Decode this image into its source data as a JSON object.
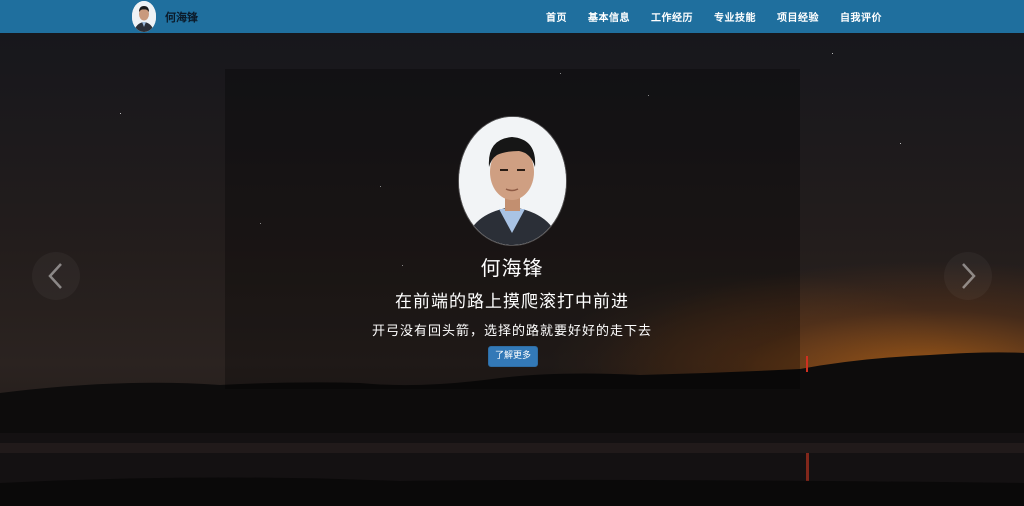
{
  "brand": {
    "name": "何海锋",
    "avatar_icon": "profile-photo"
  },
  "nav": {
    "items": [
      {
        "label": "首页"
      },
      {
        "label": "基本信息"
      },
      {
        "label": "工作经历"
      },
      {
        "label": "专业技能"
      },
      {
        "label": "项目经验"
      },
      {
        "label": "自我评价"
      }
    ]
  },
  "hero": {
    "name": "何海锋",
    "motto": "在前端的路上摸爬滚打中前进",
    "subtitle": "开弓没有回头箭，选择的路就要好好的走下去",
    "button_label": "了解更多",
    "prev_icon": "chevron-left-icon",
    "next_icon": "chevron-right-icon"
  },
  "colors": {
    "nav_bg": "#1f6f9e",
    "button_bg": "#3379b7",
    "text": "#ffffff"
  }
}
